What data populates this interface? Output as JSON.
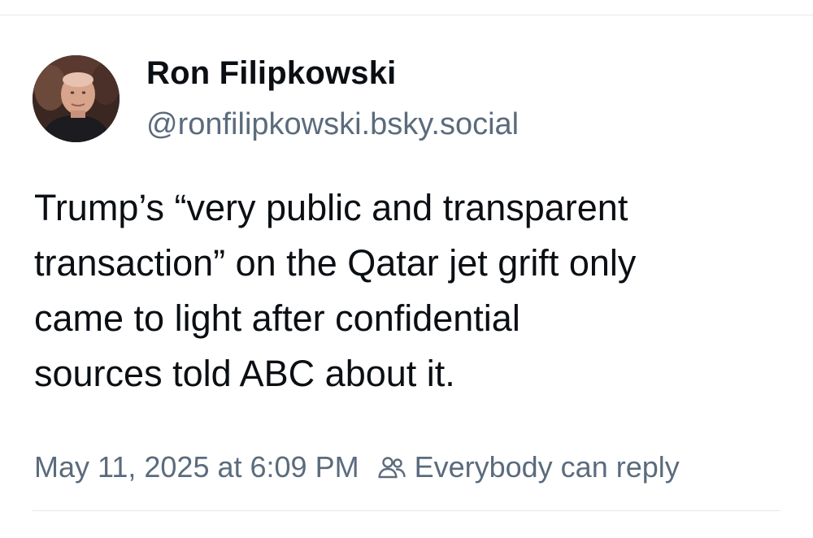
{
  "post": {
    "author": {
      "display_name": "Ron Filipkowski",
      "handle": "@ronfilipkowski.bsky.social",
      "avatar_icon": "profile-photo"
    },
    "text_lines": [
      "Trump’s “very public and transparent",
      "transaction” on the Qatar jet grift only",
      "came to light after confidential",
      "sources told ABC about it."
    ],
    "timestamp": "May 11, 2025 at 6:09 PM",
    "reply_setting": "Everybody can reply",
    "reply_icon": "people-icon"
  },
  "colors": {
    "text_primary": "#0b0f14",
    "text_secondary": "#5b6b7d",
    "divider": "#e6e8eb"
  }
}
